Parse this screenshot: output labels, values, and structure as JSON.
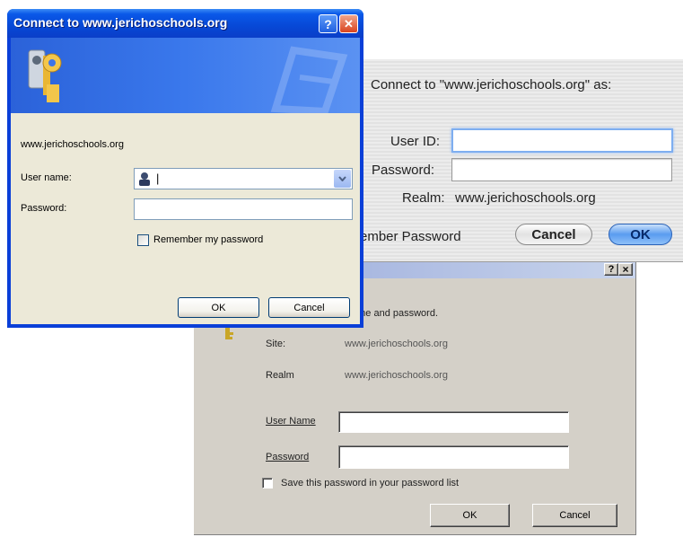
{
  "win98": {
    "help_glyph": "?",
    "close_glyph": "×",
    "prompt": "ter name and password.",
    "site_label": "Site:",
    "site_value": "www.jerichoschools.org",
    "realm_label": "Realm",
    "realm_value": "www.jerichoschools.org",
    "username_label": "User Name",
    "username_value": "",
    "password_label": "Password",
    "password_value": "",
    "save_label": "Save this password in your password list",
    "ok_label": "OK",
    "cancel_label": "Cancel"
  },
  "mac": {
    "heading": "Connect to \"www.jerichoschools.org\" as:",
    "userid_label": "User ID:",
    "userid_value": "",
    "password_label": "Password:",
    "password_value": "",
    "realm_label": "Realm:",
    "realm_value": "www.jerichoschools.org",
    "remember_label": "ember Password",
    "cancel_label": "Cancel",
    "ok_label": "OK"
  },
  "xp": {
    "title": "Connect to www.jerichoschools.org",
    "help_glyph": "?",
    "close_glyph": "✕",
    "site": "www.jerichoschools.org",
    "username_label": "User name:",
    "username_value": "|",
    "password_label": "Password:",
    "password_value": "",
    "remember_label": "Remember my password",
    "ok_label": "OK",
    "cancel_label": "Cancel"
  },
  "colors": {
    "xp_title": "#0a58e8",
    "xp_client": "#ece9d8",
    "mac_default_button": "#5a9cf0",
    "win98_face": "#d4d0c8"
  }
}
